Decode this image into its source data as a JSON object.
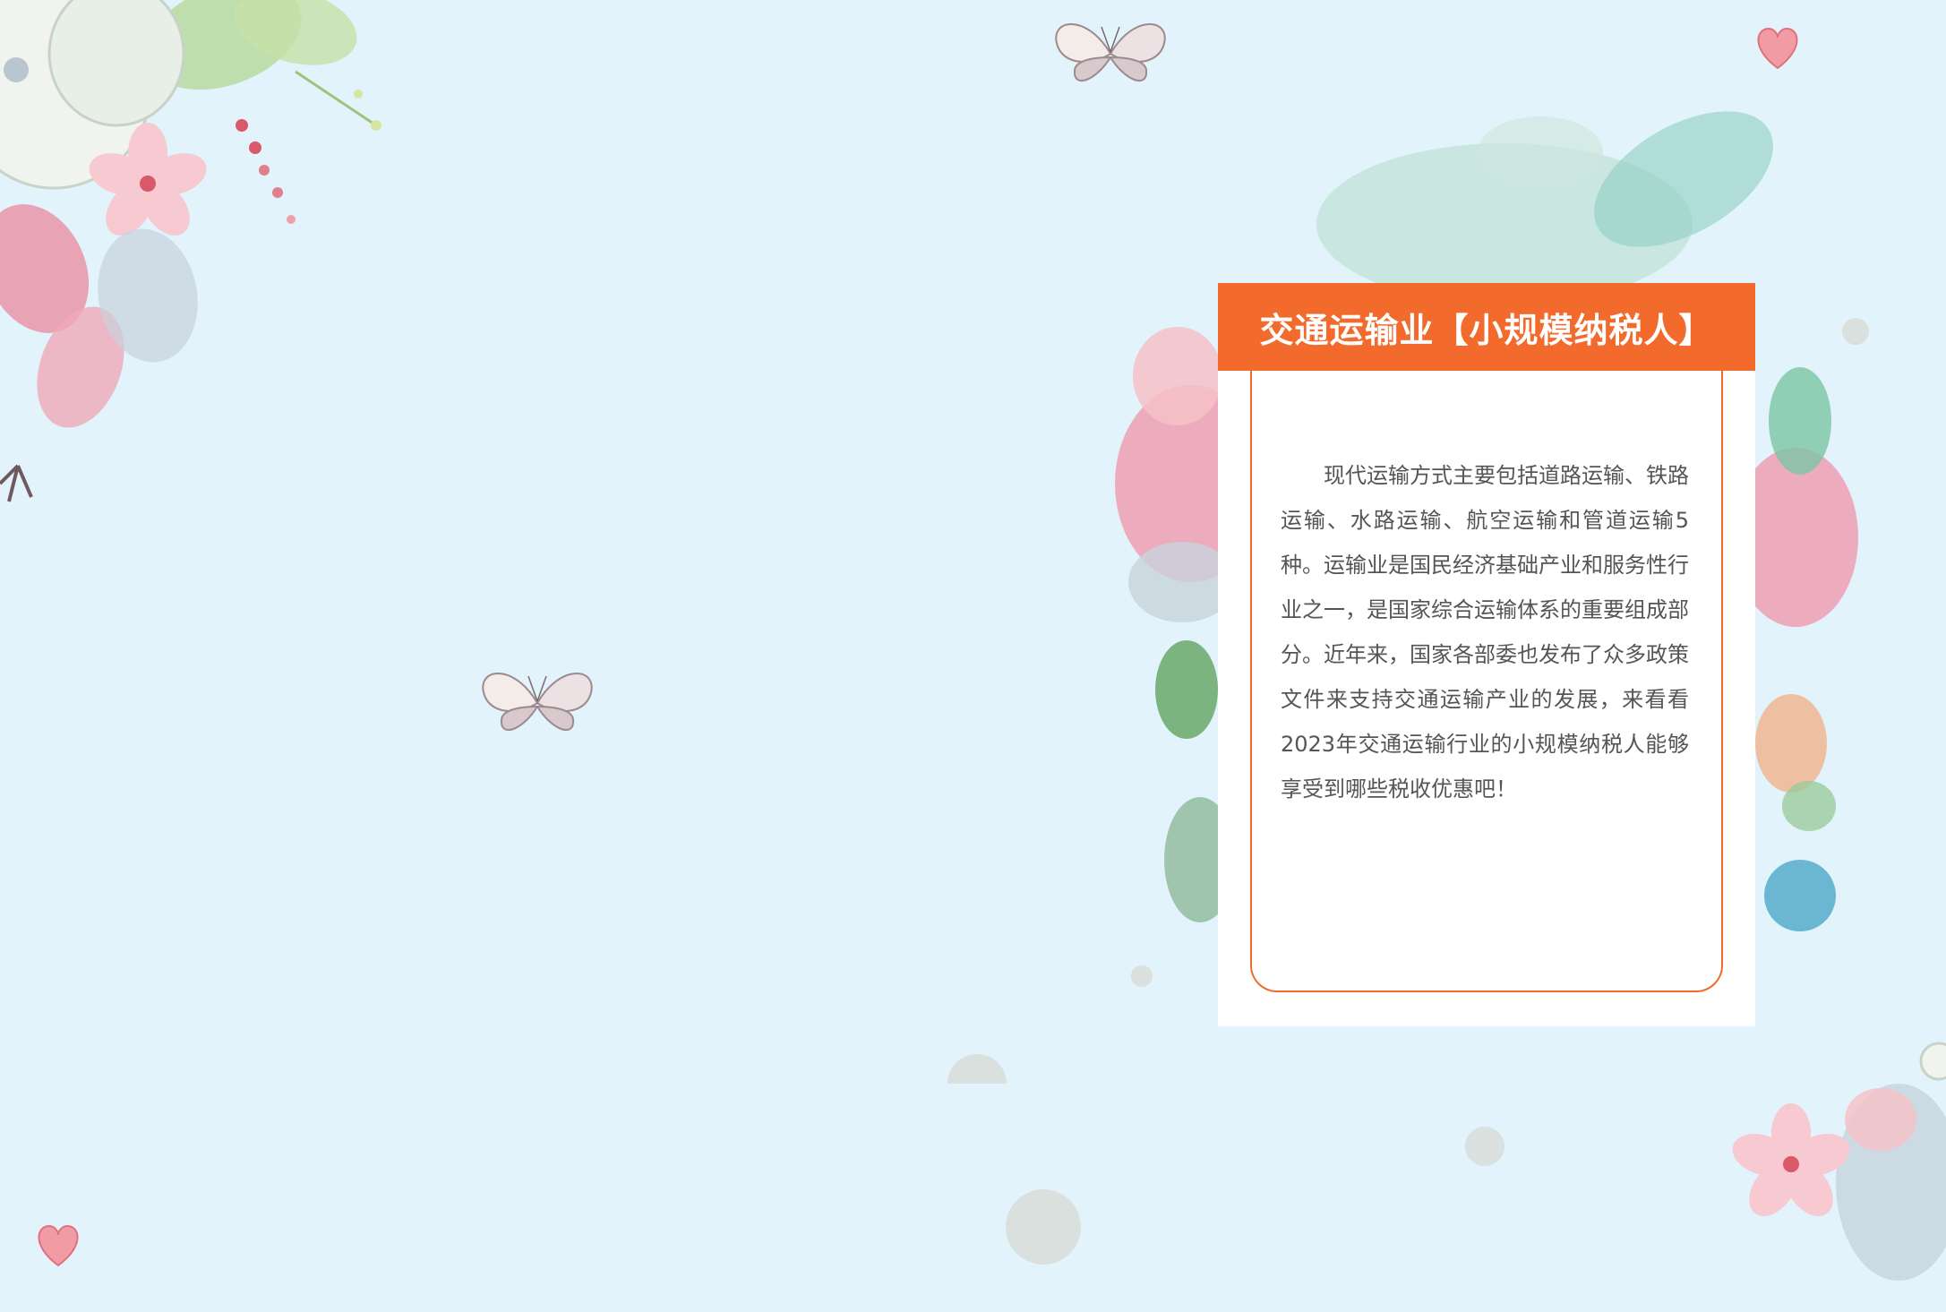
{
  "card": {
    "title": "交通运输业【小规模纳税人】",
    "body": "现代运输方式主要包括道路运输、铁路运输、水路运输、航空运输和管道运输5种。运输业是国民经济基础产业和服务性行业之一，是国家综合运输体系的重要组成部分。近年来，国家各部委也发布了众多政策文件来支持交通运输产业的发展，来看看2023年交通运输行业的小规模纳税人能够享受到哪些税收优惠吧！"
  },
  "colors": {
    "background": "#e2f3fb",
    "accent": "#f26a2c",
    "card_background": "#ffffff",
    "body_text": "#555555"
  },
  "decorations": [
    "watercolor-flower-icon",
    "leaf-spray-icon",
    "butterfly-icon",
    "heart-icon",
    "bokeh-circle-icon"
  ]
}
